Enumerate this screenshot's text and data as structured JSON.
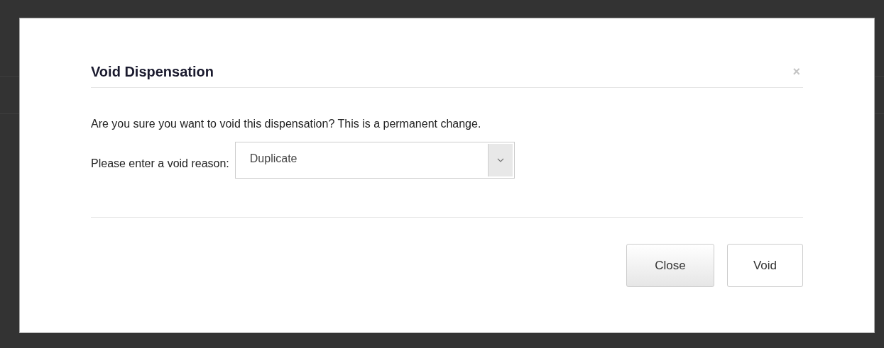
{
  "dialog": {
    "title": "Void Dispensation",
    "close_icon": "×",
    "message": "Are you sure you want to void this dispensation? This is a permanent change.",
    "reason_label": "Please enter a void reason:",
    "reason_value": "Duplicate",
    "buttons": [
      "Close",
      "Void"
    ]
  }
}
